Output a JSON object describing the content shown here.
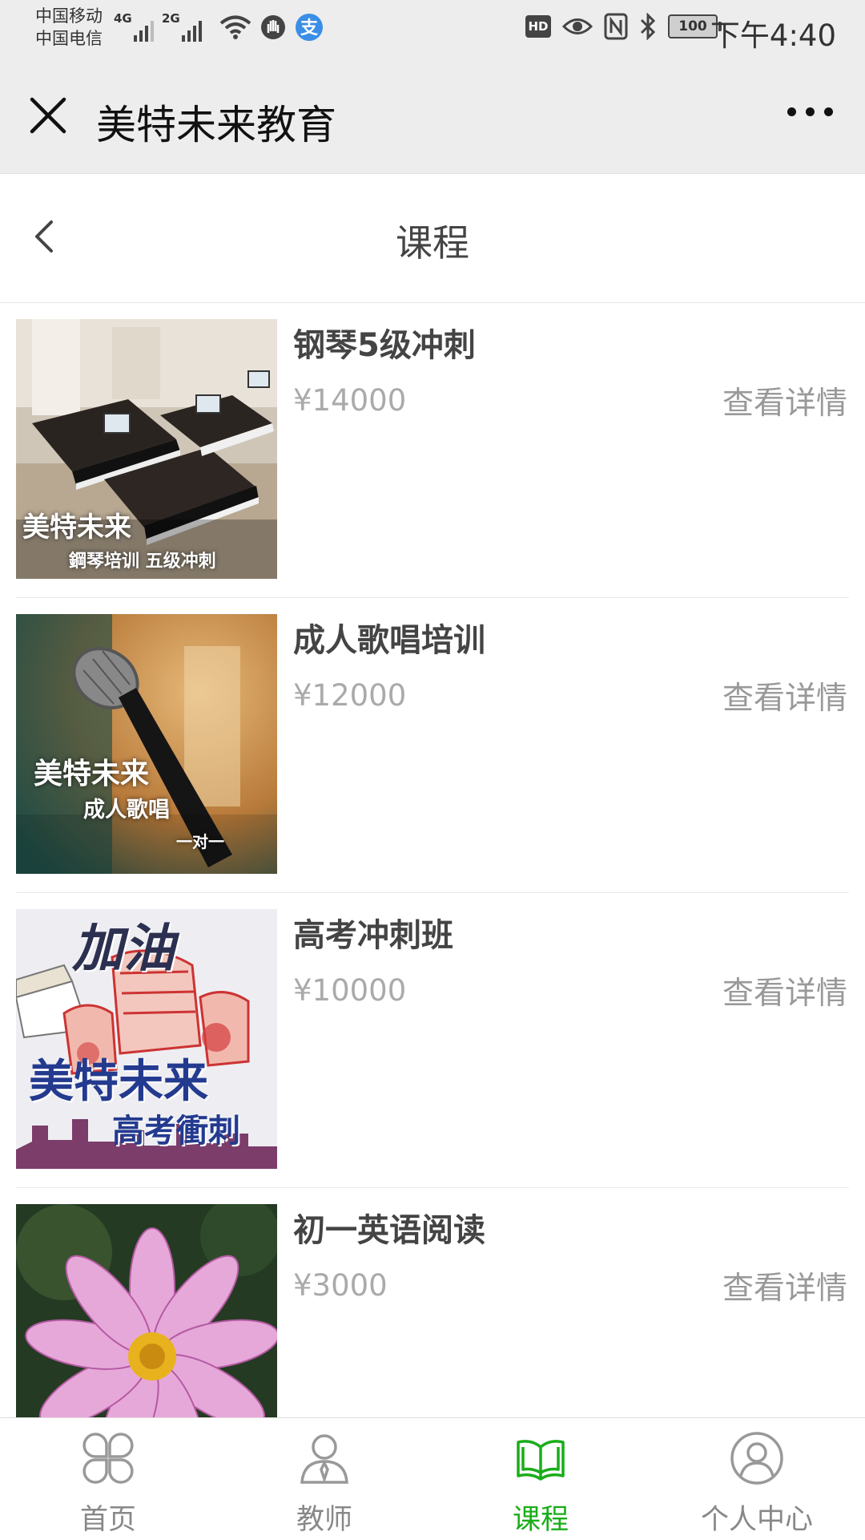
{
  "status_bar": {
    "carrier_1": "中国移动",
    "carrier_2": "中国电信",
    "signal_1": "4G",
    "signal_2": "2G",
    "hd": "HD",
    "battery": "100",
    "time": "下午4:40"
  },
  "titlebar": {
    "title": "美特未来教育"
  },
  "page": {
    "title": "课程"
  },
  "courses": [
    {
      "name": "钢琴5级冲刺",
      "price": "¥14000",
      "detail": "查看详情",
      "thumb_title": "美特未来",
      "thumb_sub": "鋼琴培训 五级冲刺"
    },
    {
      "name": "成人歌唱培训",
      "price": "¥12000",
      "detail": "查看详情",
      "thumb_title": "美特未来",
      "thumb_sub": "成人歌唱",
      "thumb_sub2": "一对一"
    },
    {
      "name": "高考冲刺班",
      "price": "¥10000",
      "detail": "查看详情",
      "thumb_top": "加油",
      "thumb_title": "美特未来",
      "thumb_sub": "高考衝刺"
    },
    {
      "name": "初一英语阅读",
      "price": "¥3000",
      "detail": "查看详情"
    }
  ],
  "tabbar": {
    "items": [
      {
        "label": "首页",
        "icon": "clover-home-icon",
        "active": false
      },
      {
        "label": "教师",
        "icon": "teacher-icon",
        "active": false
      },
      {
        "label": "课程",
        "icon": "book-icon",
        "active": true
      },
      {
        "label": "个人中心",
        "icon": "user-circle-icon",
        "active": false
      }
    ],
    "active_color": "#1aad19",
    "inactive_color": "#888888"
  }
}
